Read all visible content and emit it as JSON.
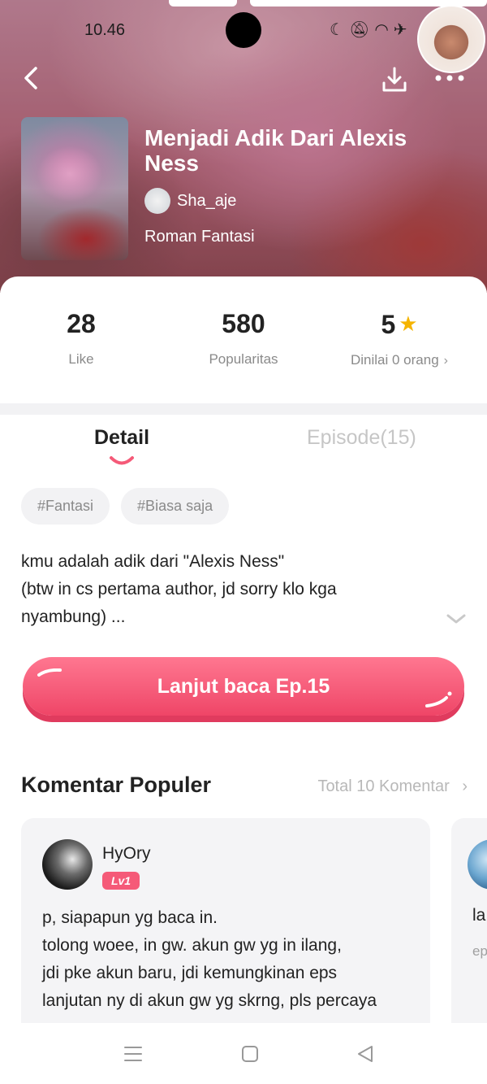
{
  "status_bar": {
    "time": "10.46",
    "icons": [
      "moon-icon",
      "bell-off-icon",
      "wifi-icon",
      "airplane-icon",
      "battery-icon"
    ]
  },
  "header": {
    "title": "Menjadi Adik Dari Alexis Ness",
    "author": "Sha_aje",
    "genre": "Roman Fantasi"
  },
  "stats": {
    "likes": "28",
    "likes_label": "Like",
    "popularity": "580",
    "popularity_label": "Popularitas",
    "rating": "5",
    "rating_label": "Dinilai 0 orang"
  },
  "tabs": {
    "detail": "Detail",
    "episode": "Episode(15)"
  },
  "tags": [
    "#Fantasi",
    "#Biasa saja"
  ],
  "description": {
    "lines": [
      "kmu adalah adik dari \"Alexis Ness\"",
      "(btw in cs pertama author, jd sorry klo kga",
      "nyambung) ..."
    ]
  },
  "cta": {
    "label": "Lanjut baca Ep.15"
  },
  "comments": {
    "title": "Komentar Populer",
    "total": "Total 10 Komentar",
    "items": [
      {
        "user": "HyOry",
        "badge": "Lv1",
        "lines": [
          "p, siapapun yg baca in.",
          "tolong woee, in gw. akun gw yg in ilang,",
          "jdi pke akun baru, jdi kemungkinan eps",
          "lanjutan ny di akun gw yg skrng, pls percaya"
        ]
      },
      {
        "text": "la",
        "sub": "ep"
      }
    ]
  },
  "colors": {
    "accent": "#f55a78",
    "star": "#f5b400",
    "muted": "#8a8a8a"
  }
}
